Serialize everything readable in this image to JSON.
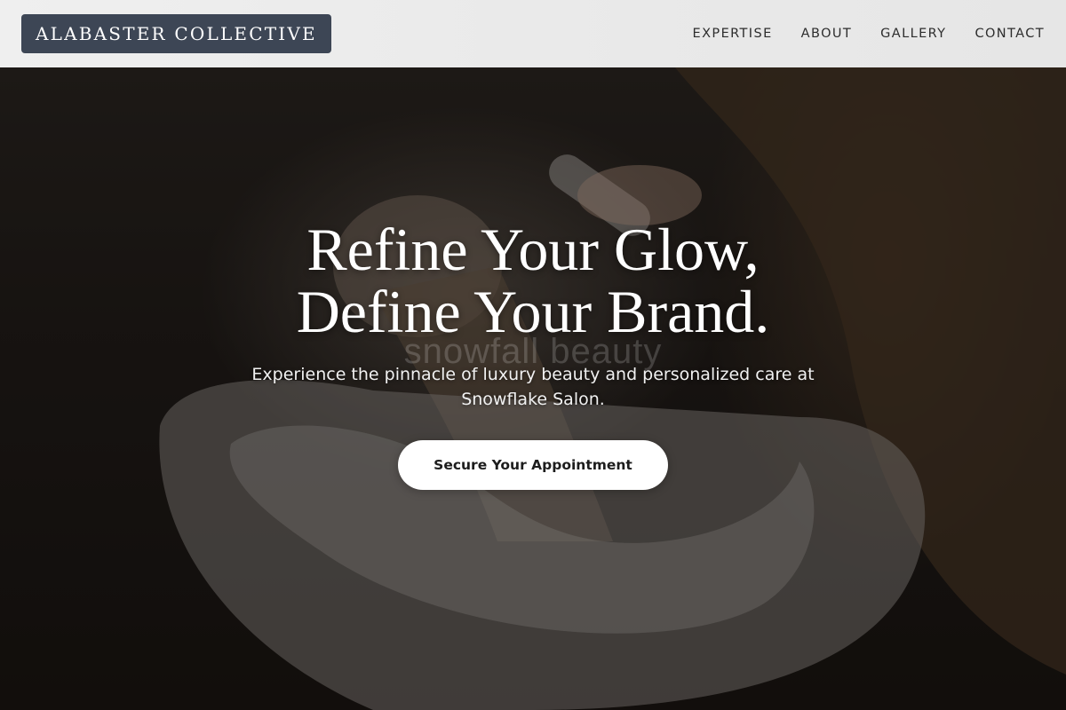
{
  "header": {
    "brand": "ALABASTER COLLECTIVE",
    "nav": [
      "EXPERTISE",
      "ABOUT",
      "GALLERY",
      "CONTACT"
    ]
  },
  "hero": {
    "headline_line1": "Refine Your Glow,",
    "headline_line2": "Define Your Brand.",
    "watermark": "snowfall beauty",
    "subtitle": "Experience the pinnacle of luxury beauty and personalized care at Snowflake Salon.",
    "cta_label": "Secure Your Appointment"
  },
  "colors": {
    "header_bg": "#efefef",
    "logo_bg": "#3d4655",
    "cta_bg": "#ffffff",
    "headline": "#ffffff"
  }
}
